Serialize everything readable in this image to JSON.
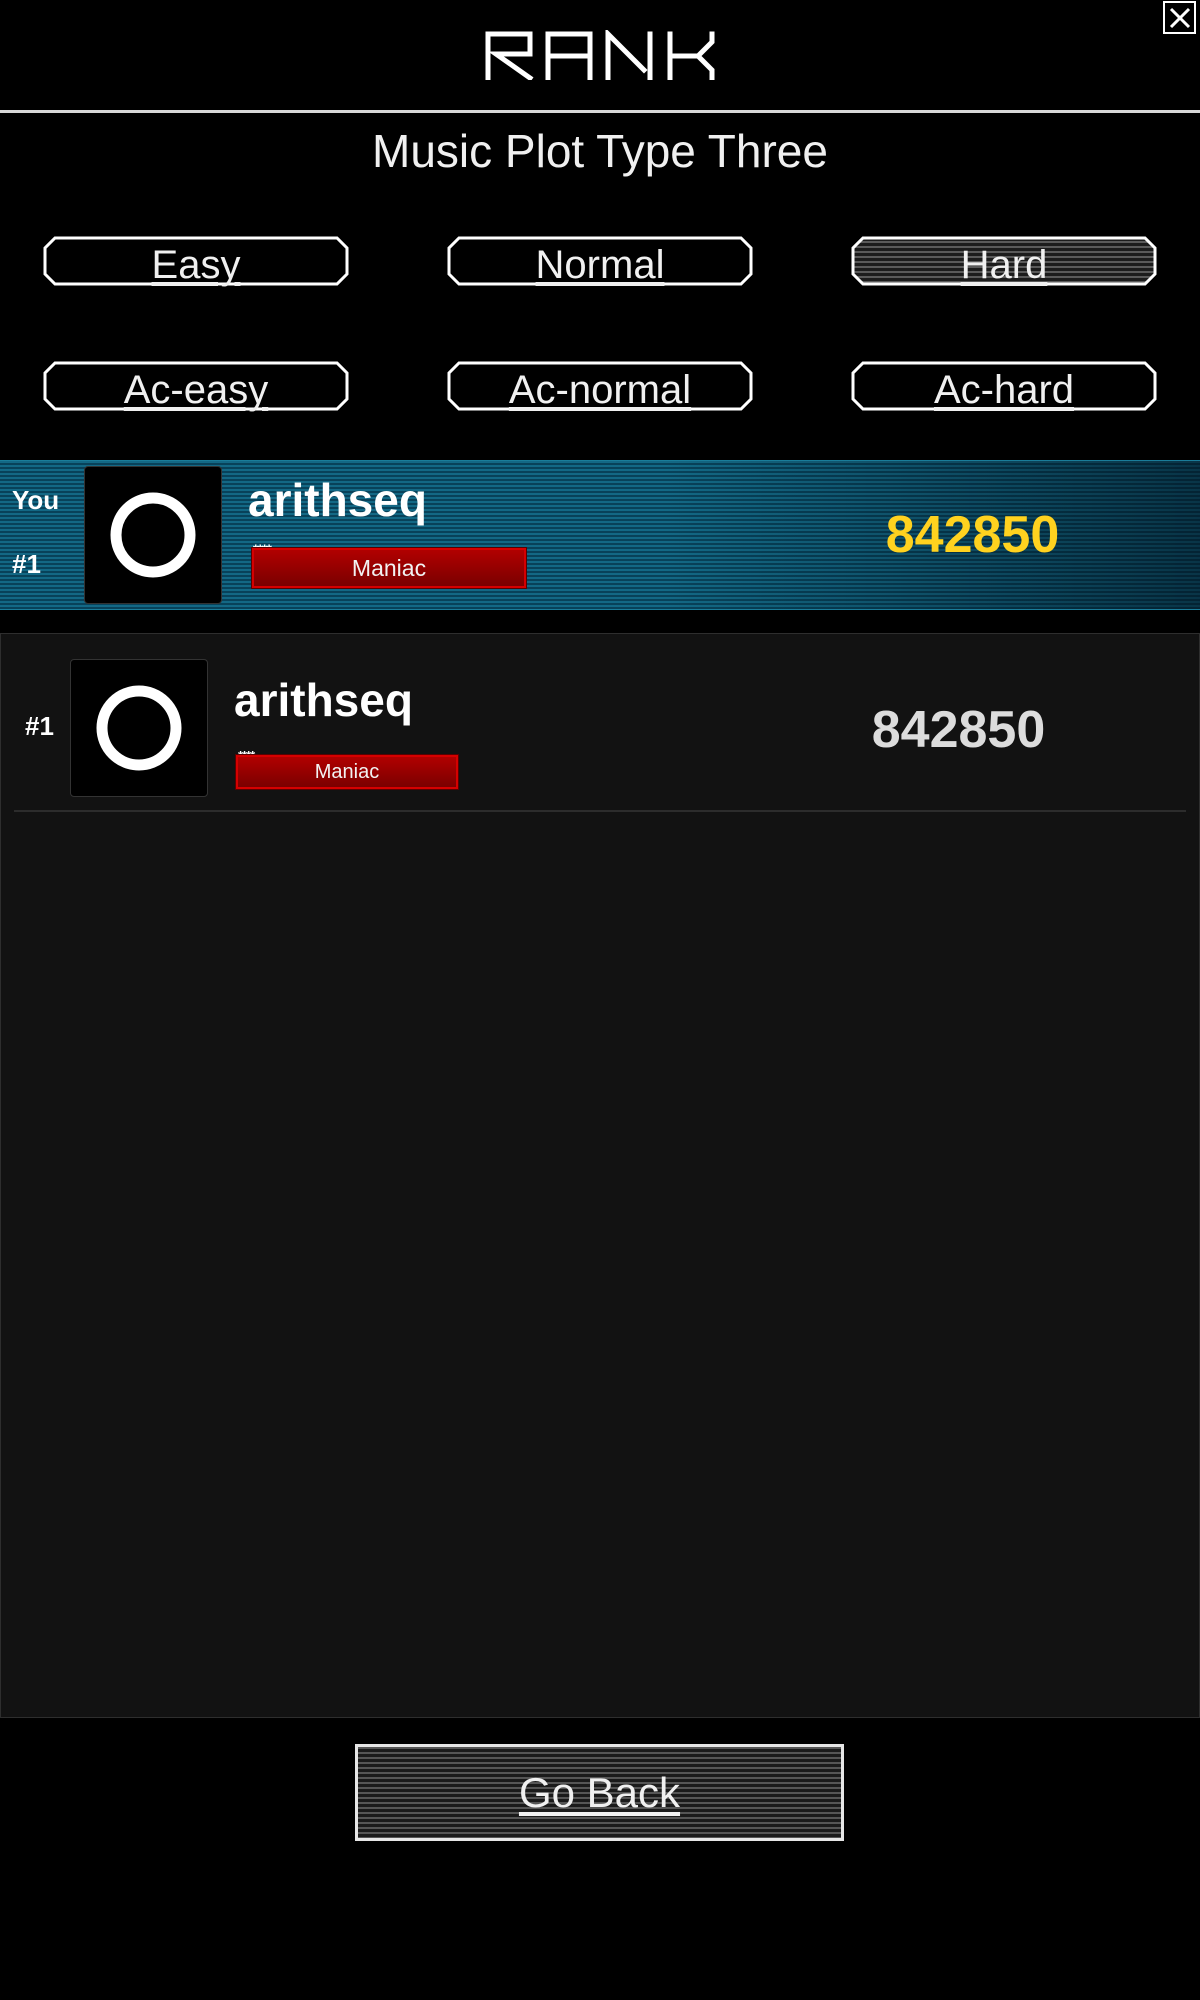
{
  "header": {
    "title": "RANK",
    "close_icon": "close-icon"
  },
  "song": {
    "title": "Music Plot Type Three"
  },
  "difficulties": [
    {
      "label": "Easy",
      "selected": false
    },
    {
      "label": "Normal",
      "selected": false
    },
    {
      "label": "Hard",
      "selected": true
    },
    {
      "label": "Ac-easy",
      "selected": false
    },
    {
      "label": "Ac-normal",
      "selected": false
    },
    {
      "label": "Ac-hard",
      "selected": false
    }
  ],
  "you_entry": {
    "you_label": "You",
    "rank": "#1",
    "name": "arithseq",
    "stars": "****",
    "title_badge": "Maniac",
    "score": "842850",
    "avatar_icon": "ring-icon"
  },
  "ranking": [
    {
      "rank": "#1",
      "name": "arithseq",
      "stars": "****",
      "title_badge": "Maniac",
      "score": "842850",
      "avatar_icon": "ring-icon"
    }
  ],
  "footer": {
    "go_back_label": "Go Back"
  },
  "colors": {
    "background": "#000000",
    "you_row": "#0e5a78",
    "you_score": "#ffd21f",
    "list_score": "#dcdcdc",
    "badge": "#a00000"
  }
}
